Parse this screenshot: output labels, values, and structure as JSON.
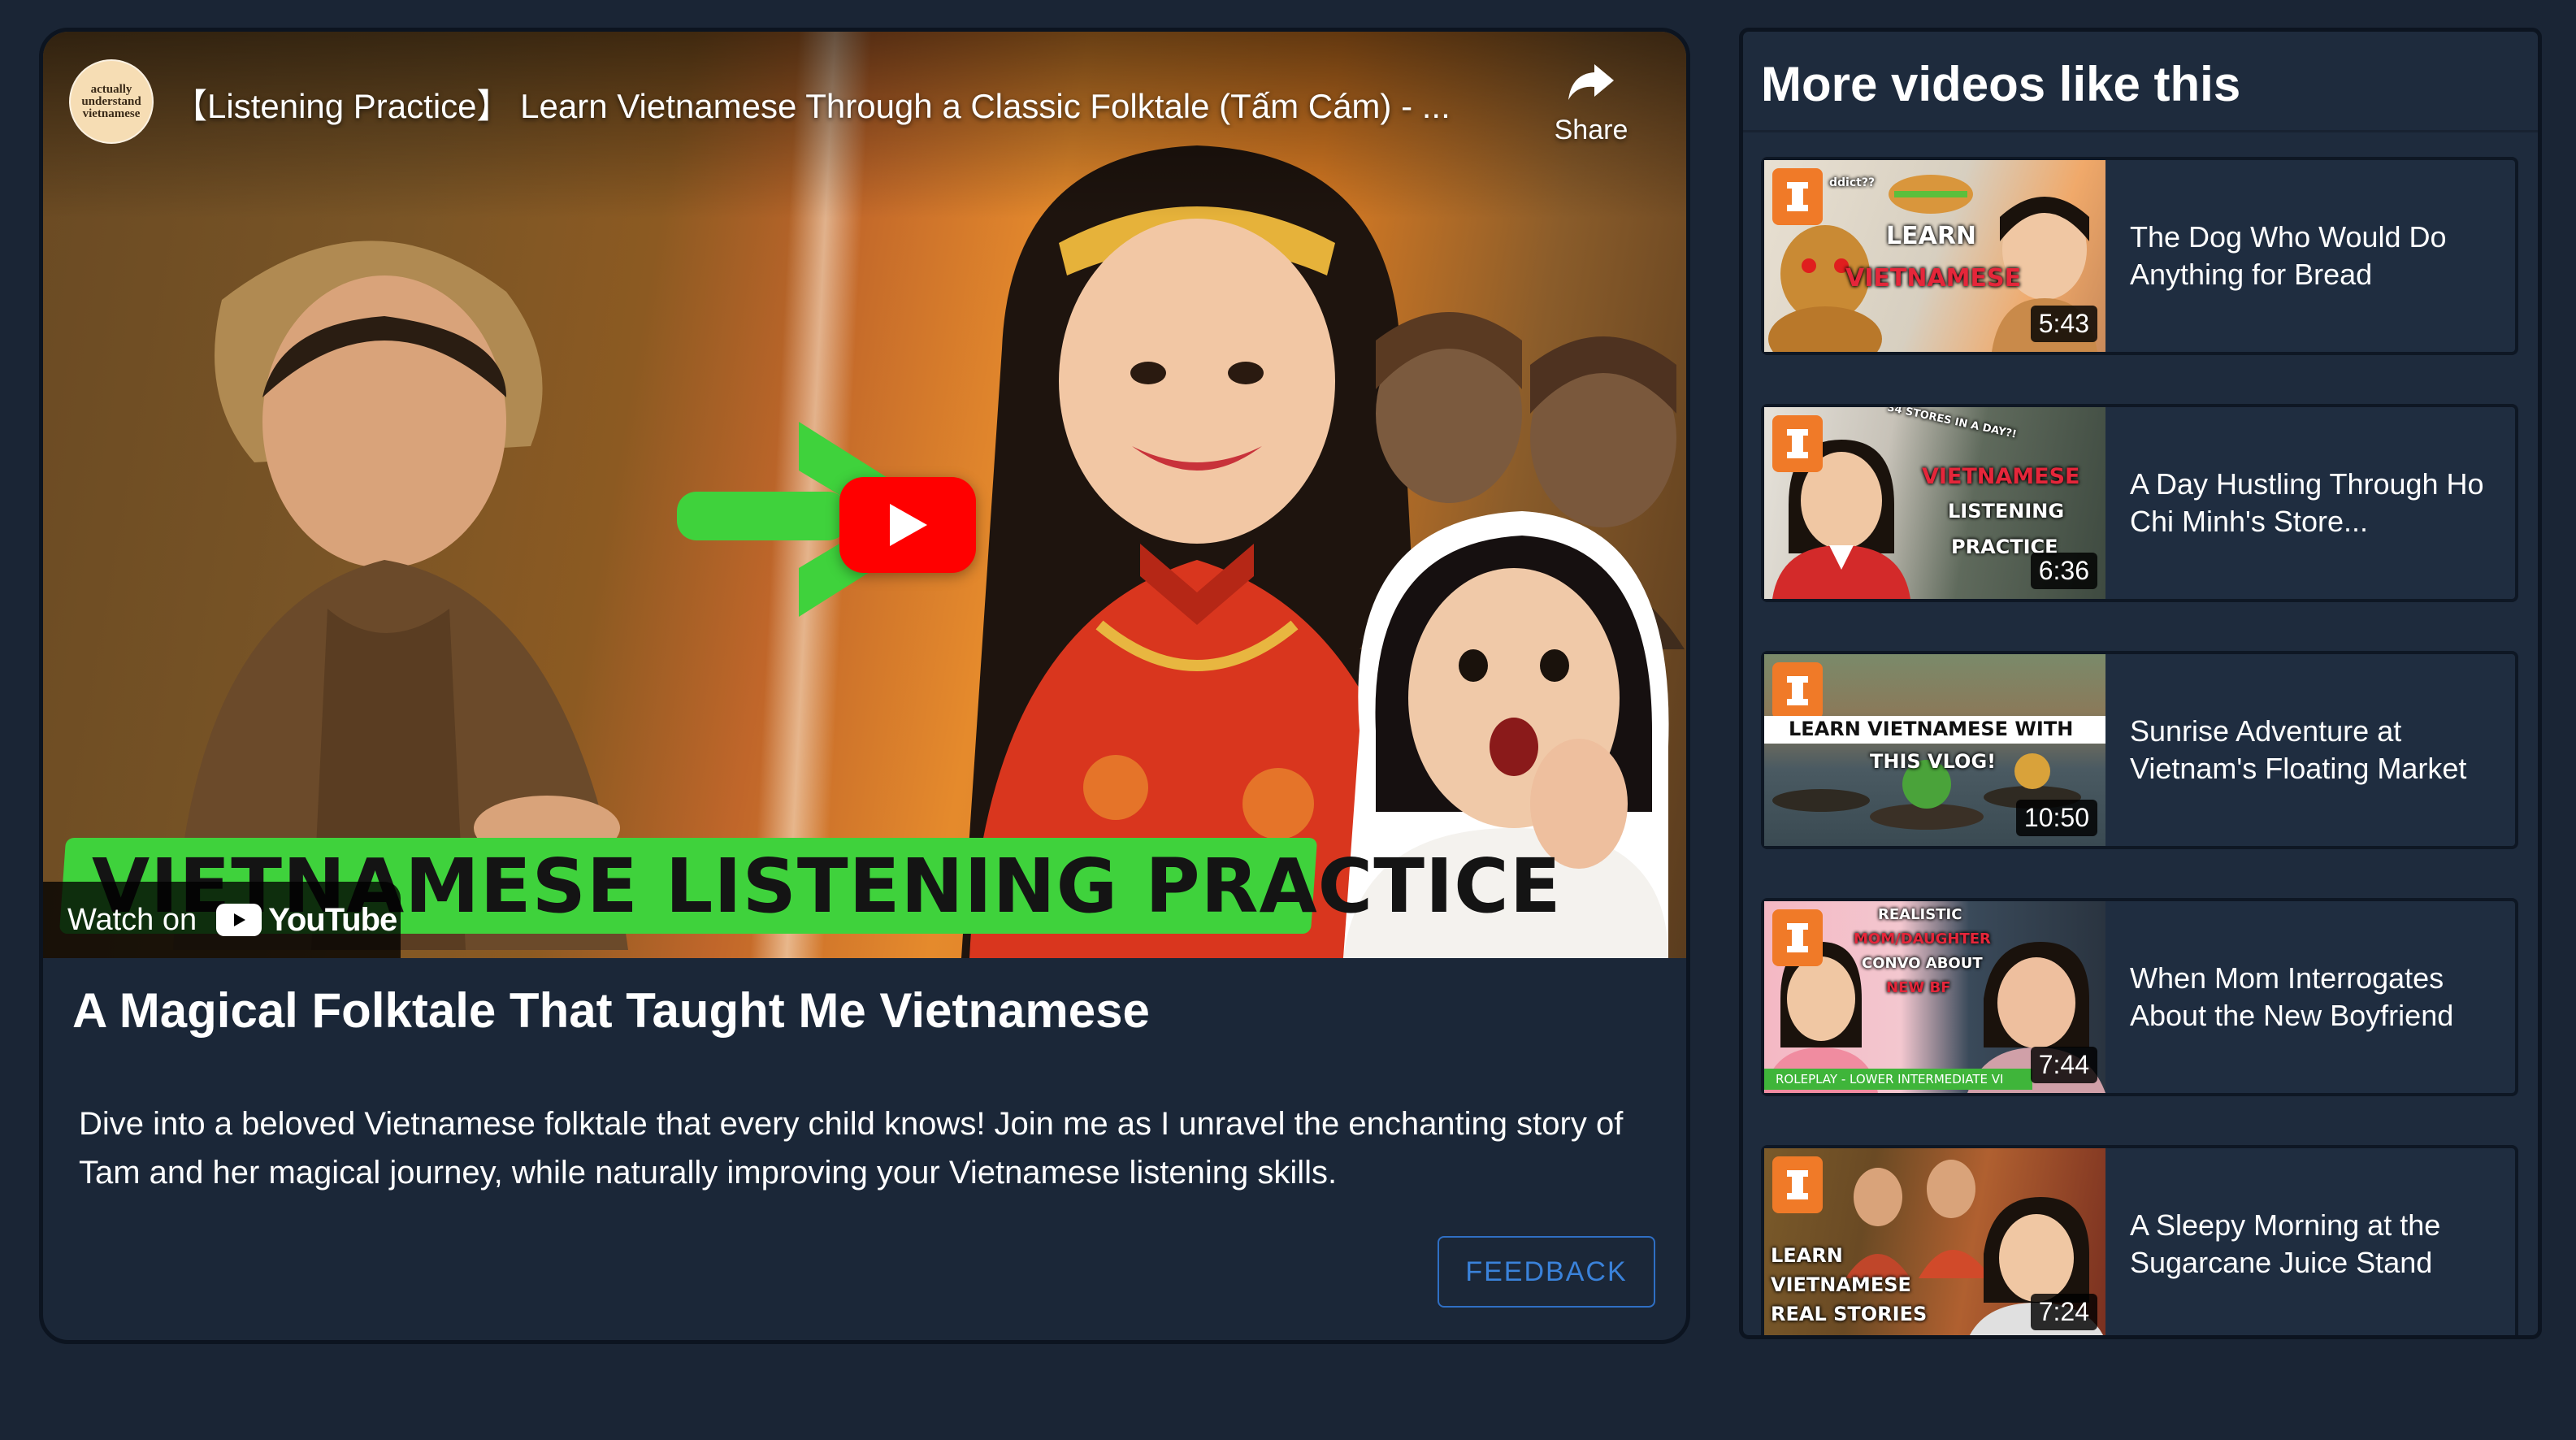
{
  "player": {
    "channel_avatar_text": "actually understand vietnamese",
    "video_title": "【Listening Practice】 Learn Vietnamese Through a Classic Folktale (Tấm Cám) - ...",
    "share_label": "Share",
    "banner_text": "VIETNAMESE LISTENING PRACTICE",
    "watch_on_label": "Watch on",
    "youtube_label": "YouTube"
  },
  "main": {
    "title": "A Magical Folktale That Taught Me Vietnamese",
    "description": "Dive into a beloved Vietnamese folktale that every child knows! Join me as I unravel the enchanting story of Tam and her magical journey, while naturally improving your Vietnamese listening skills.",
    "feedback_label": "FEEDBACK"
  },
  "sidebar": {
    "title": "More videos like this",
    "videos": [
      {
        "title": "The Dog Who Would Do Anything for Bread",
        "duration": "5:43",
        "thumb_lines": [
          "ddict??",
          "LEARN",
          "VIETNAMESE"
        ]
      },
      {
        "title": "A Day Hustling Through Ho Chi Minh's Store...",
        "duration": "6:36",
        "thumb_lines": [
          "34 STORES IN A DAY?!",
          "VIETNAMESE",
          "LISTENING",
          "PRACTICE"
        ]
      },
      {
        "title": "Sunrise Adventure at Vietnam's Floating Market",
        "duration": "10:50",
        "thumb_lines": [
          "LEARN VIETNAMESE WITH",
          "THIS VLOG!"
        ]
      },
      {
        "title": "When Mom Interrogates About the New Boyfriend",
        "duration": "7:44",
        "thumb_lines": [
          "REALISTIC",
          "MOM/DAUGHTER",
          "CONVO ABOUT",
          "NEW BF",
          "ROLEPLAY - LOWER INTERMEDIATE VI"
        ]
      },
      {
        "title": "A Sleepy Morning at the Sugarcane Juice Stand",
        "duration": "7:24",
        "thumb_lines": [
          "LEARN",
          "VIETNAMESE",
          "REAL STORIES"
        ]
      }
    ]
  },
  "colors": {
    "page_background": "#1a2535",
    "card_background": "#1b2738",
    "youtube_red": "#ff0000",
    "banner_green": "#3fd23c",
    "feedback_blue": "#3a82da",
    "badge_orange": "#f07a28"
  }
}
